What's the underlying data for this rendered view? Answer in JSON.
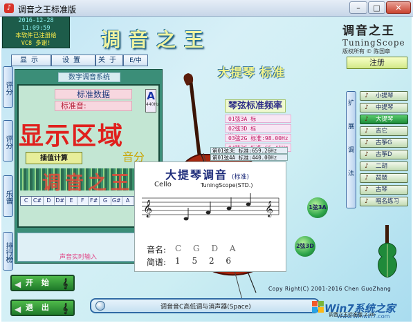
{
  "window": {
    "title": "调音之王标准版",
    "min": "–",
    "max": "□",
    "close": "✕"
  },
  "info": {
    "date": "2016-12-28",
    "time": "11:09:59",
    "registered": "本软件已注册给",
    "user": "VC8  多谢!"
  },
  "brand": "调音之王",
  "logo": {
    "cn": "调音之王",
    "en": "TuningScope",
    "rights": "版权所有 © 陈国章"
  },
  "tabs": [
    "显示",
    "设置",
    "关于",
    "E/中"
  ],
  "left_side": [
    "评分",
    "评分",
    "乐谱",
    "排行榜"
  ],
  "panel": {
    "header": "数字调音系统",
    "std_data": "标准数据",
    "std_sound": "标准音:",
    "note": "A",
    "note_hz": "440Hz",
    "display": "显示区域",
    "score": "音分",
    "calc": "插值计算",
    "tuner": "调音之王",
    "keys": [
      "C",
      "C#",
      "D",
      "D#",
      "E",
      "F",
      "F#",
      "G",
      "G#",
      "A",
      "A#",
      "B"
    ],
    "realtime": "声音实时输入"
  },
  "buttons": {
    "start": "开 始",
    "exit": "退 出"
  },
  "instrument_title": "大提琴 标准",
  "freq": {
    "title": "琴弦标准频率",
    "rows": [
      "01弦3A 标准:220.00Hz",
      "02弦3D 标准:146.83Hz",
      "03弦2G 标准:98.00Hz",
      "04弦2C 标准:65.41Hz"
    ],
    "extra": [
      "第01弦3E 标准:659.26Hz",
      "第01弦4A 标准:440.00Hz"
    ]
  },
  "popup": {
    "title": "大提琴调音",
    "subtitle": "(标准)",
    "cello": "Cello",
    "scope": "TuningScope(STD.)",
    "label_name": "音名:",
    "label_jianpu": "简谱:",
    "names": [
      "C",
      "G",
      "D",
      "A"
    ],
    "jianpu": [
      "1",
      "5",
      "2",
      "6"
    ]
  },
  "strings": {
    "s1": "1弦3A",
    "s2": "2弦3D"
  },
  "right": {
    "register": "注册",
    "vnav": [
      "扩",
      "展",
      "调",
      "法"
    ],
    "instruments": [
      {
        "name": "小提琴",
        "icon": "violin-icon"
      },
      {
        "name": "中提琴",
        "icon": "viola-icon"
      },
      {
        "name": "大提琴",
        "icon": "cello-icon"
      },
      {
        "name": "吉它",
        "icon": "guitar-icon"
      },
      {
        "name": "古筝G",
        "icon": "guzheng-icon"
      },
      {
        "name": "古筝D",
        "icon": "guzheng-icon"
      },
      {
        "name": "二胡",
        "icon": "erhu-icon"
      },
      {
        "name": "琵琶",
        "icon": "pipa-icon"
      },
      {
        "name": "古琴",
        "icon": "guqin-icon"
      },
      {
        "name": "唱名练习",
        "icon": "sing-icon"
      }
    ],
    "active_index": 2
  },
  "copyright": "Copy Right(C) 2001-2016 Chen GuoZhang",
  "bottom_bar": "调音音C高低调与消声器(Space)",
  "bottom_name": "调音之王标准版 2.30",
  "watermark": {
    "main": "Win7系统之家",
    "url": "Www.Winwin7.com"
  },
  "colors": {
    "accent": "#2da54a",
    "panel": "#3b8e78",
    "display_red": "#e0201d"
  }
}
